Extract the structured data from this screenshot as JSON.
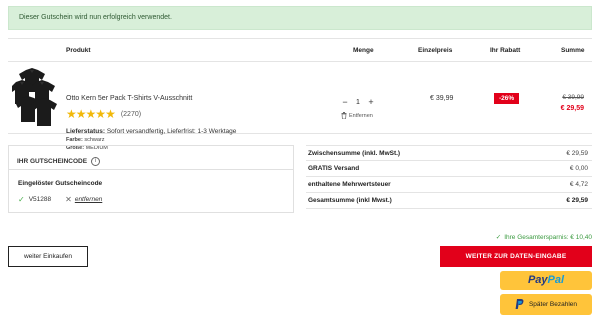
{
  "banner": {
    "text": "Dieser Gutschein wird nun erfolgreich verwendet."
  },
  "table": {
    "headers": {
      "product": "Produkt",
      "qty": "Menge",
      "unit_price": "Einzelpreis",
      "discount": "Ihr Rabatt",
      "sum": "Summe"
    }
  },
  "item": {
    "name": "Otto Kern 5er Pack T-Shirts V-Ausschnitt",
    "rating_value": 4.5,
    "rating_count": "(2270)",
    "delivery_label": "Lieferstatus:",
    "delivery_value": "Sofort versandfertig, Lieferfrist: 1-3 Werktage",
    "color_label": "Farbe:",
    "color_value": "schwarz",
    "size_label": "Größe:",
    "size_value": "MEDIUM",
    "qty_minus": "−",
    "qty": "1",
    "qty_plus": "+",
    "remove_label": "Entfernen",
    "unit_price": "€ 39,99",
    "discount_badge": "-26%",
    "old_price": "€ 39,99",
    "new_price": "€ 29,59"
  },
  "voucher": {
    "title": "IHR GUTSCHEINCODE",
    "redeemed_label": "Eingelöster Gutscheincode",
    "code": "V51288",
    "remove_link": "entfernen"
  },
  "summary": {
    "rows": [
      {
        "label": "Zwischensumme (inkl. MwSt.)",
        "value": "€ 29,59"
      },
      {
        "label": "GRATIS Versand",
        "value": "€ 0,00"
      },
      {
        "label": "enthaltene Mehrwertsteuer",
        "value": "€ 4,72"
      },
      {
        "label": "Gesamtsumme (inkl Mwst.)",
        "value": "€ 29,59"
      }
    ],
    "savings": "Ihre Gesamtersparnis: € 10,40"
  },
  "buttons": {
    "continue": "weiter Einkaufen",
    "checkout": "WEITER ZUR DATEN-EINGABE",
    "paypal_a": "Pay",
    "paypal_b": "Pal",
    "later": "Später Bezahlen"
  },
  "colors": {
    "accent_red": "#e2001a",
    "success_green": "#3a9a3f",
    "star_yellow": "#f1b80a",
    "paypal_yellow": "#ffc43a"
  }
}
